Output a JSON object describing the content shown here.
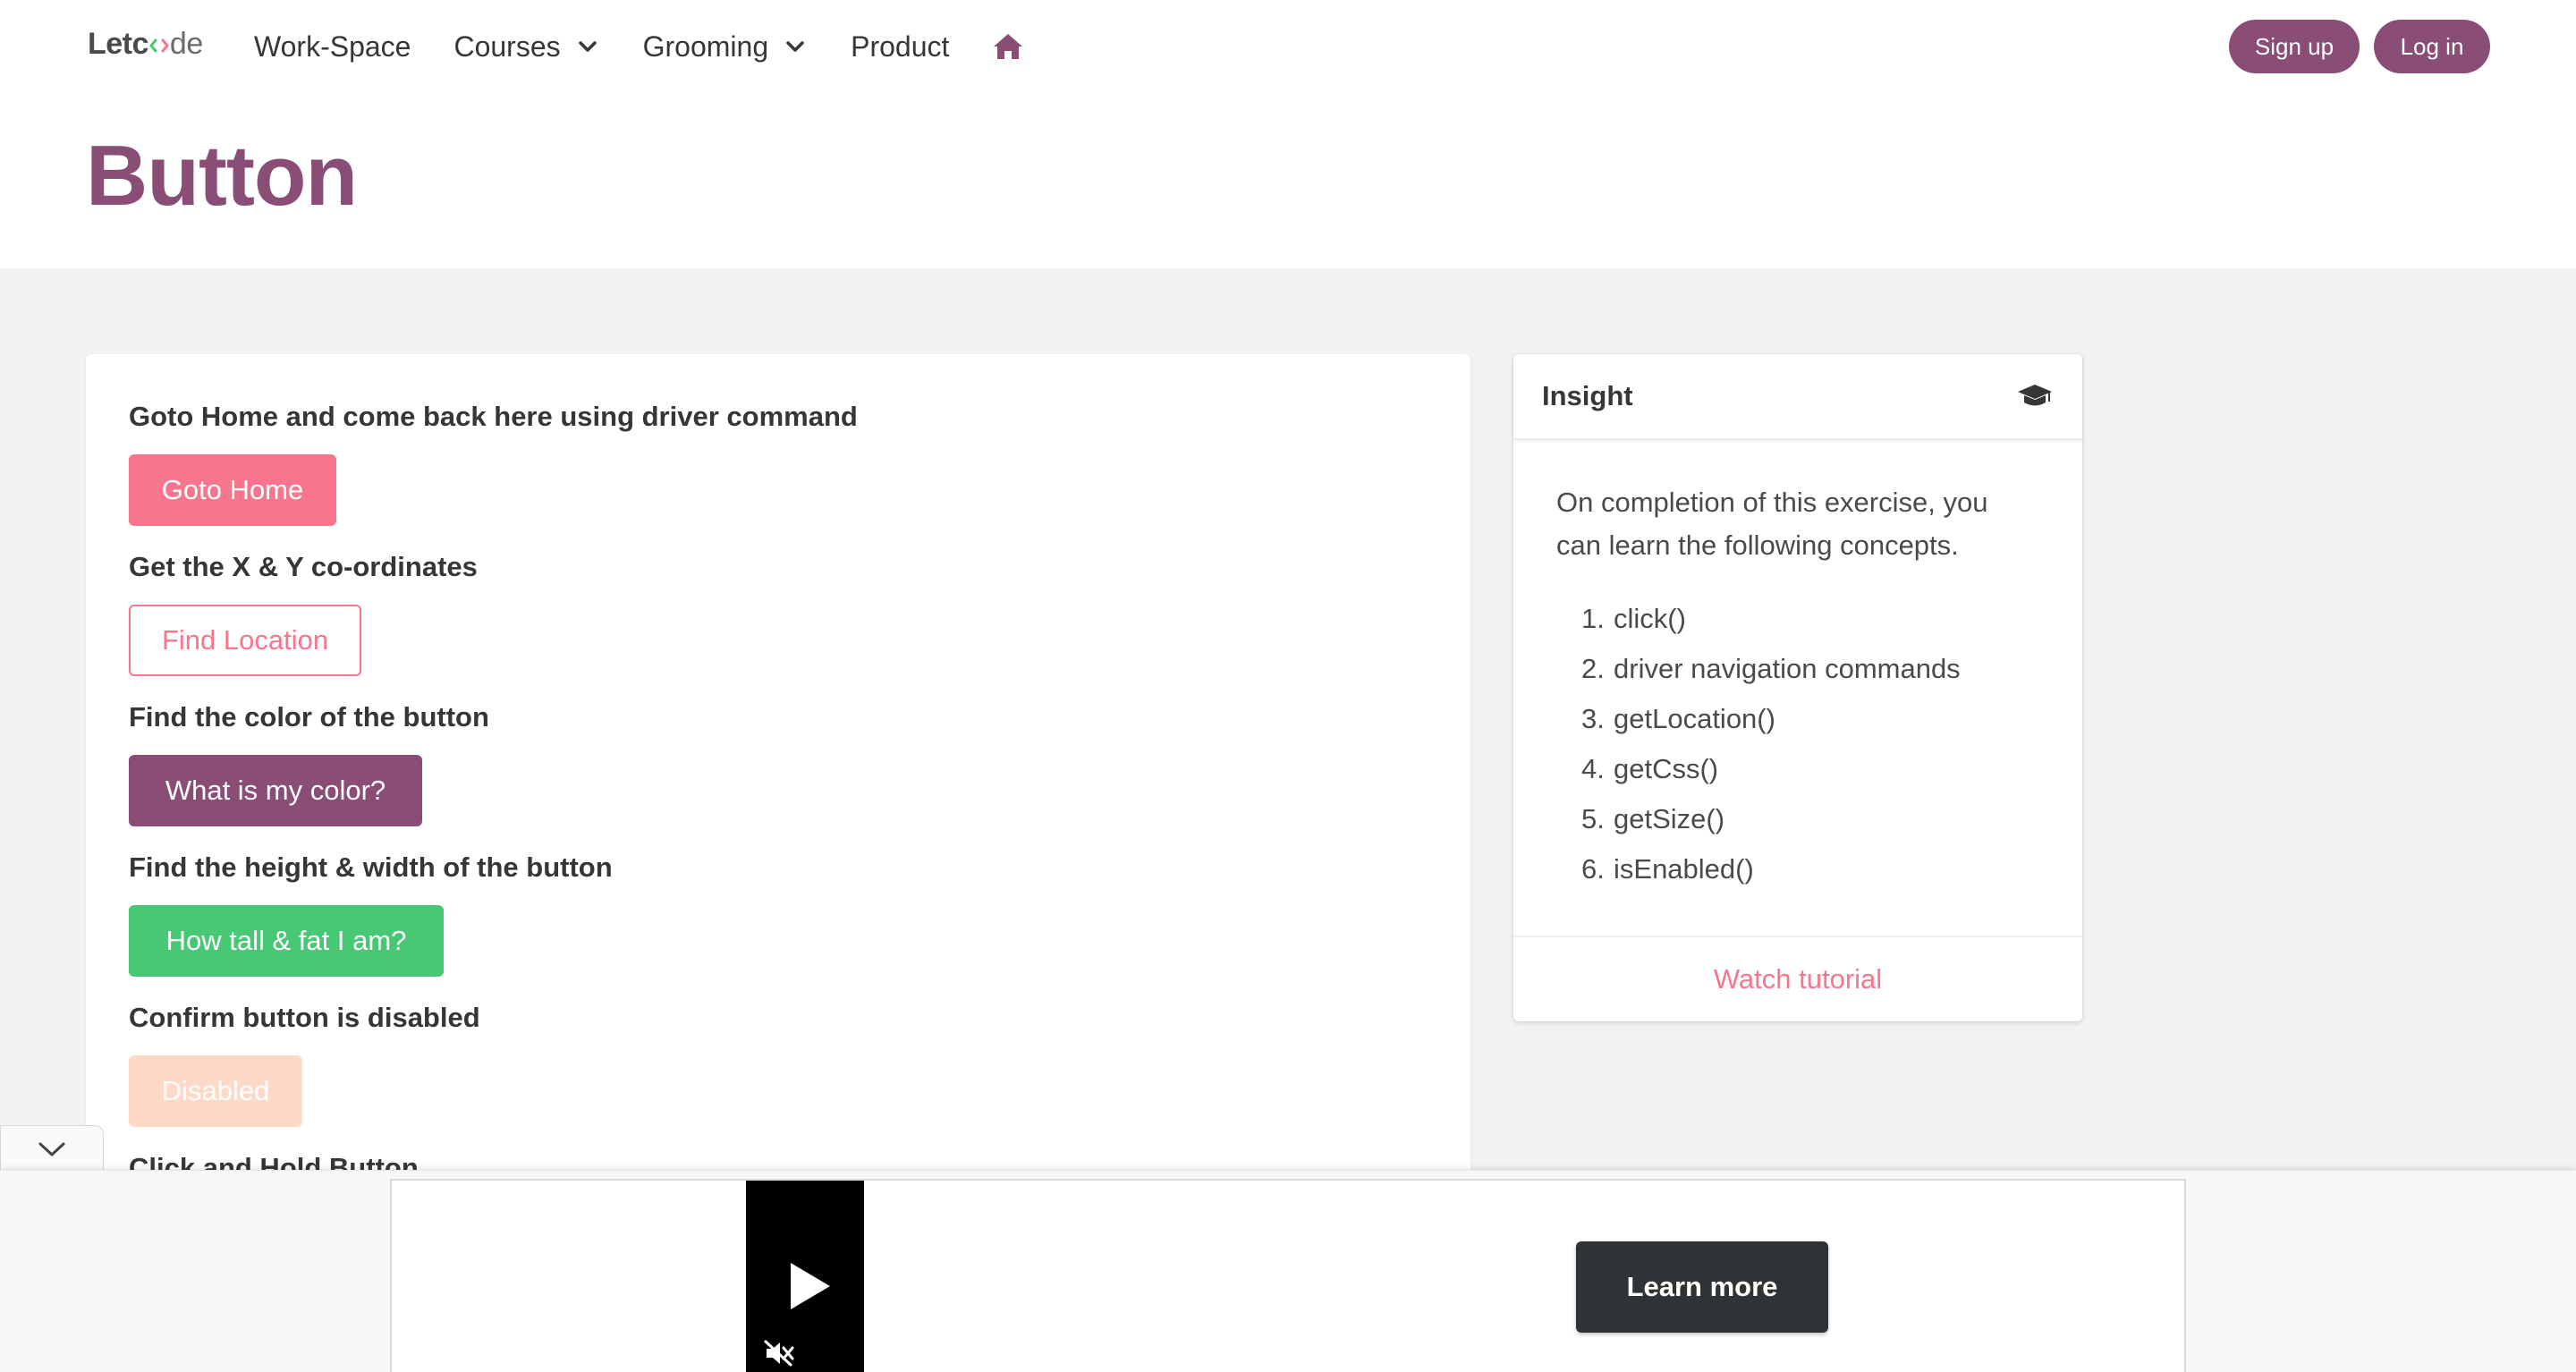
{
  "nav": {
    "logo_let": "Let",
    "logo_de": "de",
    "items": [
      {
        "label": "Work-Space",
        "dropdown": false
      },
      {
        "label": "Courses",
        "dropdown": true
      },
      {
        "label": "Grooming",
        "dropdown": true
      },
      {
        "label": "Product",
        "dropdown": false
      }
    ],
    "home_icon": "home-icon",
    "signup_label": "Sign up",
    "login_label": "Log in"
  },
  "page": {
    "title": "Button"
  },
  "exercises": [
    {
      "label": "Goto Home and come back here using driver command",
      "button": "Goto Home"
    },
    {
      "label": "Get the X & Y co-ordinates",
      "button": "Find Location"
    },
    {
      "label": "Find the color of the button",
      "button": "What is my color?"
    },
    {
      "label": "Find the height & width of the button",
      "button": "How tall & fat I am?"
    },
    {
      "label": "Confirm button is disabled",
      "button": "Disabled"
    },
    {
      "label": "Click and Hold Button",
      "button": ""
    }
  ],
  "insight": {
    "title": "Insight",
    "icon": "graduation-cap-icon",
    "description": "On completion of this exercise, you can learn the following concepts.",
    "concepts": [
      "click()",
      "driver navigation commands",
      "getLocation()",
      "getCss()",
      "getSize()",
      "isEnabled()"
    ],
    "footer_link": "Watch tutorial"
  },
  "ad": {
    "cta": "Learn more",
    "play_icon": "play-icon",
    "mute_icon": "muted-speaker-icon",
    "collapse_icon": "chevron-down-icon"
  },
  "colors": {
    "brand": "#8a4d76",
    "pink": "#f7768e",
    "green": "#48c774",
    "disabled": "#ffd7c6",
    "logo_accent": "#48c774"
  }
}
